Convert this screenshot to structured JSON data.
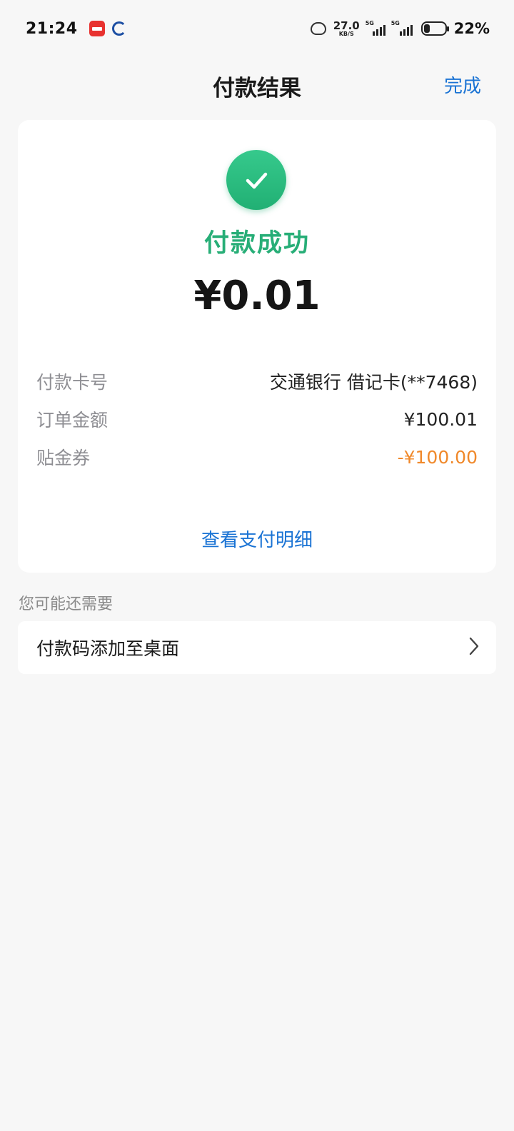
{
  "status_bar": {
    "time": "21:24",
    "net_speed": "27.0",
    "net_unit": "KB/S",
    "sim1": "5G",
    "sim2": "5G",
    "battery": "22%"
  },
  "header": {
    "title": "付款结果",
    "done_label": "完成"
  },
  "result": {
    "status_text": "付款成功",
    "amount": "¥0.01",
    "success_color": "#27ae77",
    "details": [
      {
        "label": "付款卡号",
        "value": "交通银行 借记卡(**7468)"
      },
      {
        "label": "订单金额",
        "value": "¥100.01"
      },
      {
        "label": "贴金券",
        "value": "-¥100.00"
      }
    ],
    "view_detail_label": "查看支付明细"
  },
  "suggestions": {
    "section_title": "您可能还需要",
    "items": [
      {
        "label": "付款码添加至桌面",
        "icon": "chevron-right-icon"
      }
    ]
  },
  "colors": {
    "link": "#1a73d4",
    "discount": "#f0892b",
    "background": "#f7f7f7"
  }
}
